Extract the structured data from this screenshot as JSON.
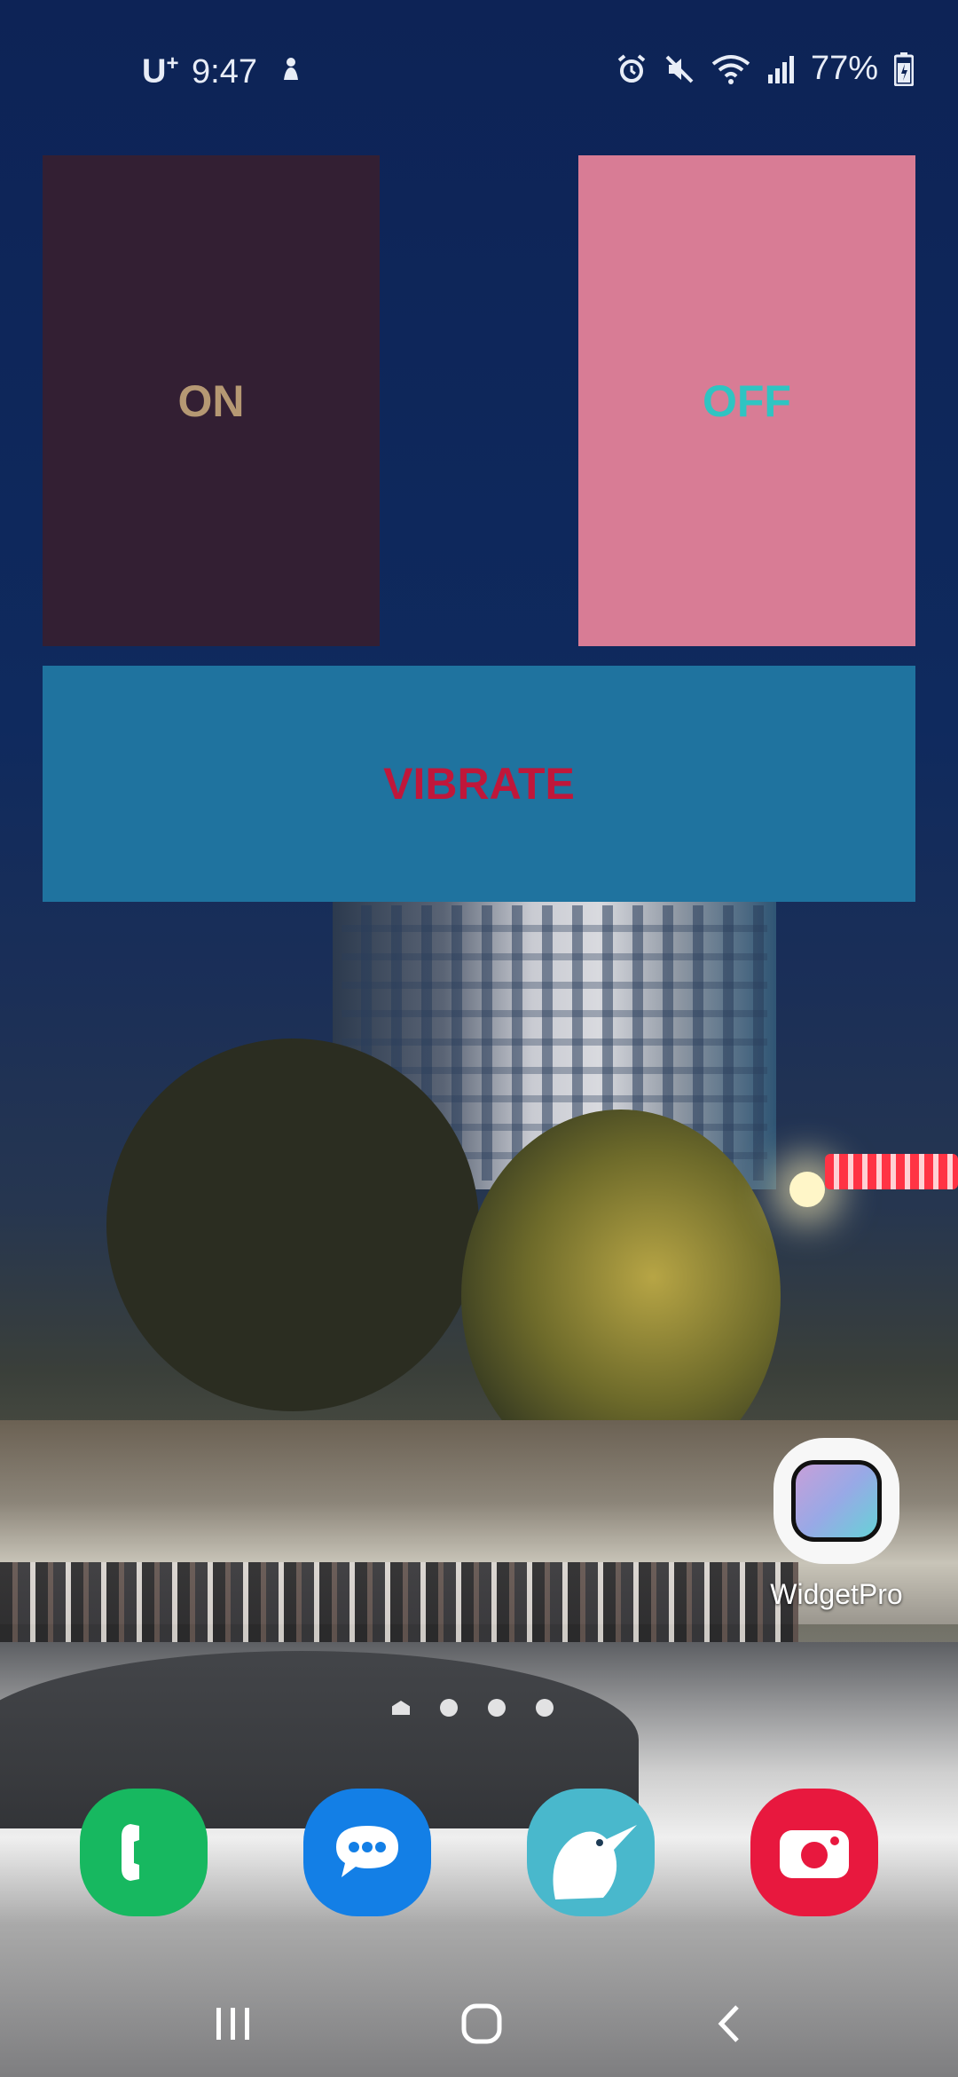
{
  "status_bar": {
    "carrier": "U",
    "carrier_superscript": "+",
    "time": "9:47",
    "battery": "77%",
    "icons": [
      "person-icon",
      "alarm-icon",
      "mute-icon",
      "wifi-icon",
      "signal-icon",
      "battery-icon"
    ]
  },
  "widgets": {
    "on": {
      "label": "ON",
      "background": "#331f33",
      "text_color": "#b59873"
    },
    "off": {
      "label": "OFF",
      "background": "#d87c95",
      "text_color": "#2fc4c2"
    },
    "vibrate": {
      "label": "VIBRATE",
      "background": "#1f739f",
      "text_color": "#c0173a"
    }
  },
  "home_apps": [
    {
      "name": "WidgetPro",
      "icon": "widgetpro-icon"
    }
  ],
  "page_indicator": {
    "pages": 4,
    "current": 4,
    "first_is_home": true
  },
  "dock": [
    {
      "icon": "phone-icon",
      "color": "#17b860"
    },
    {
      "icon": "messages-icon",
      "color": "#137fe6"
    },
    {
      "icon": "kiwi-browser-icon",
      "color": "#49b8cc"
    },
    {
      "icon": "camera-icon",
      "color": "#e8183e"
    }
  ],
  "nav_bar": [
    "recents-icon",
    "home-icon",
    "back-icon"
  ]
}
